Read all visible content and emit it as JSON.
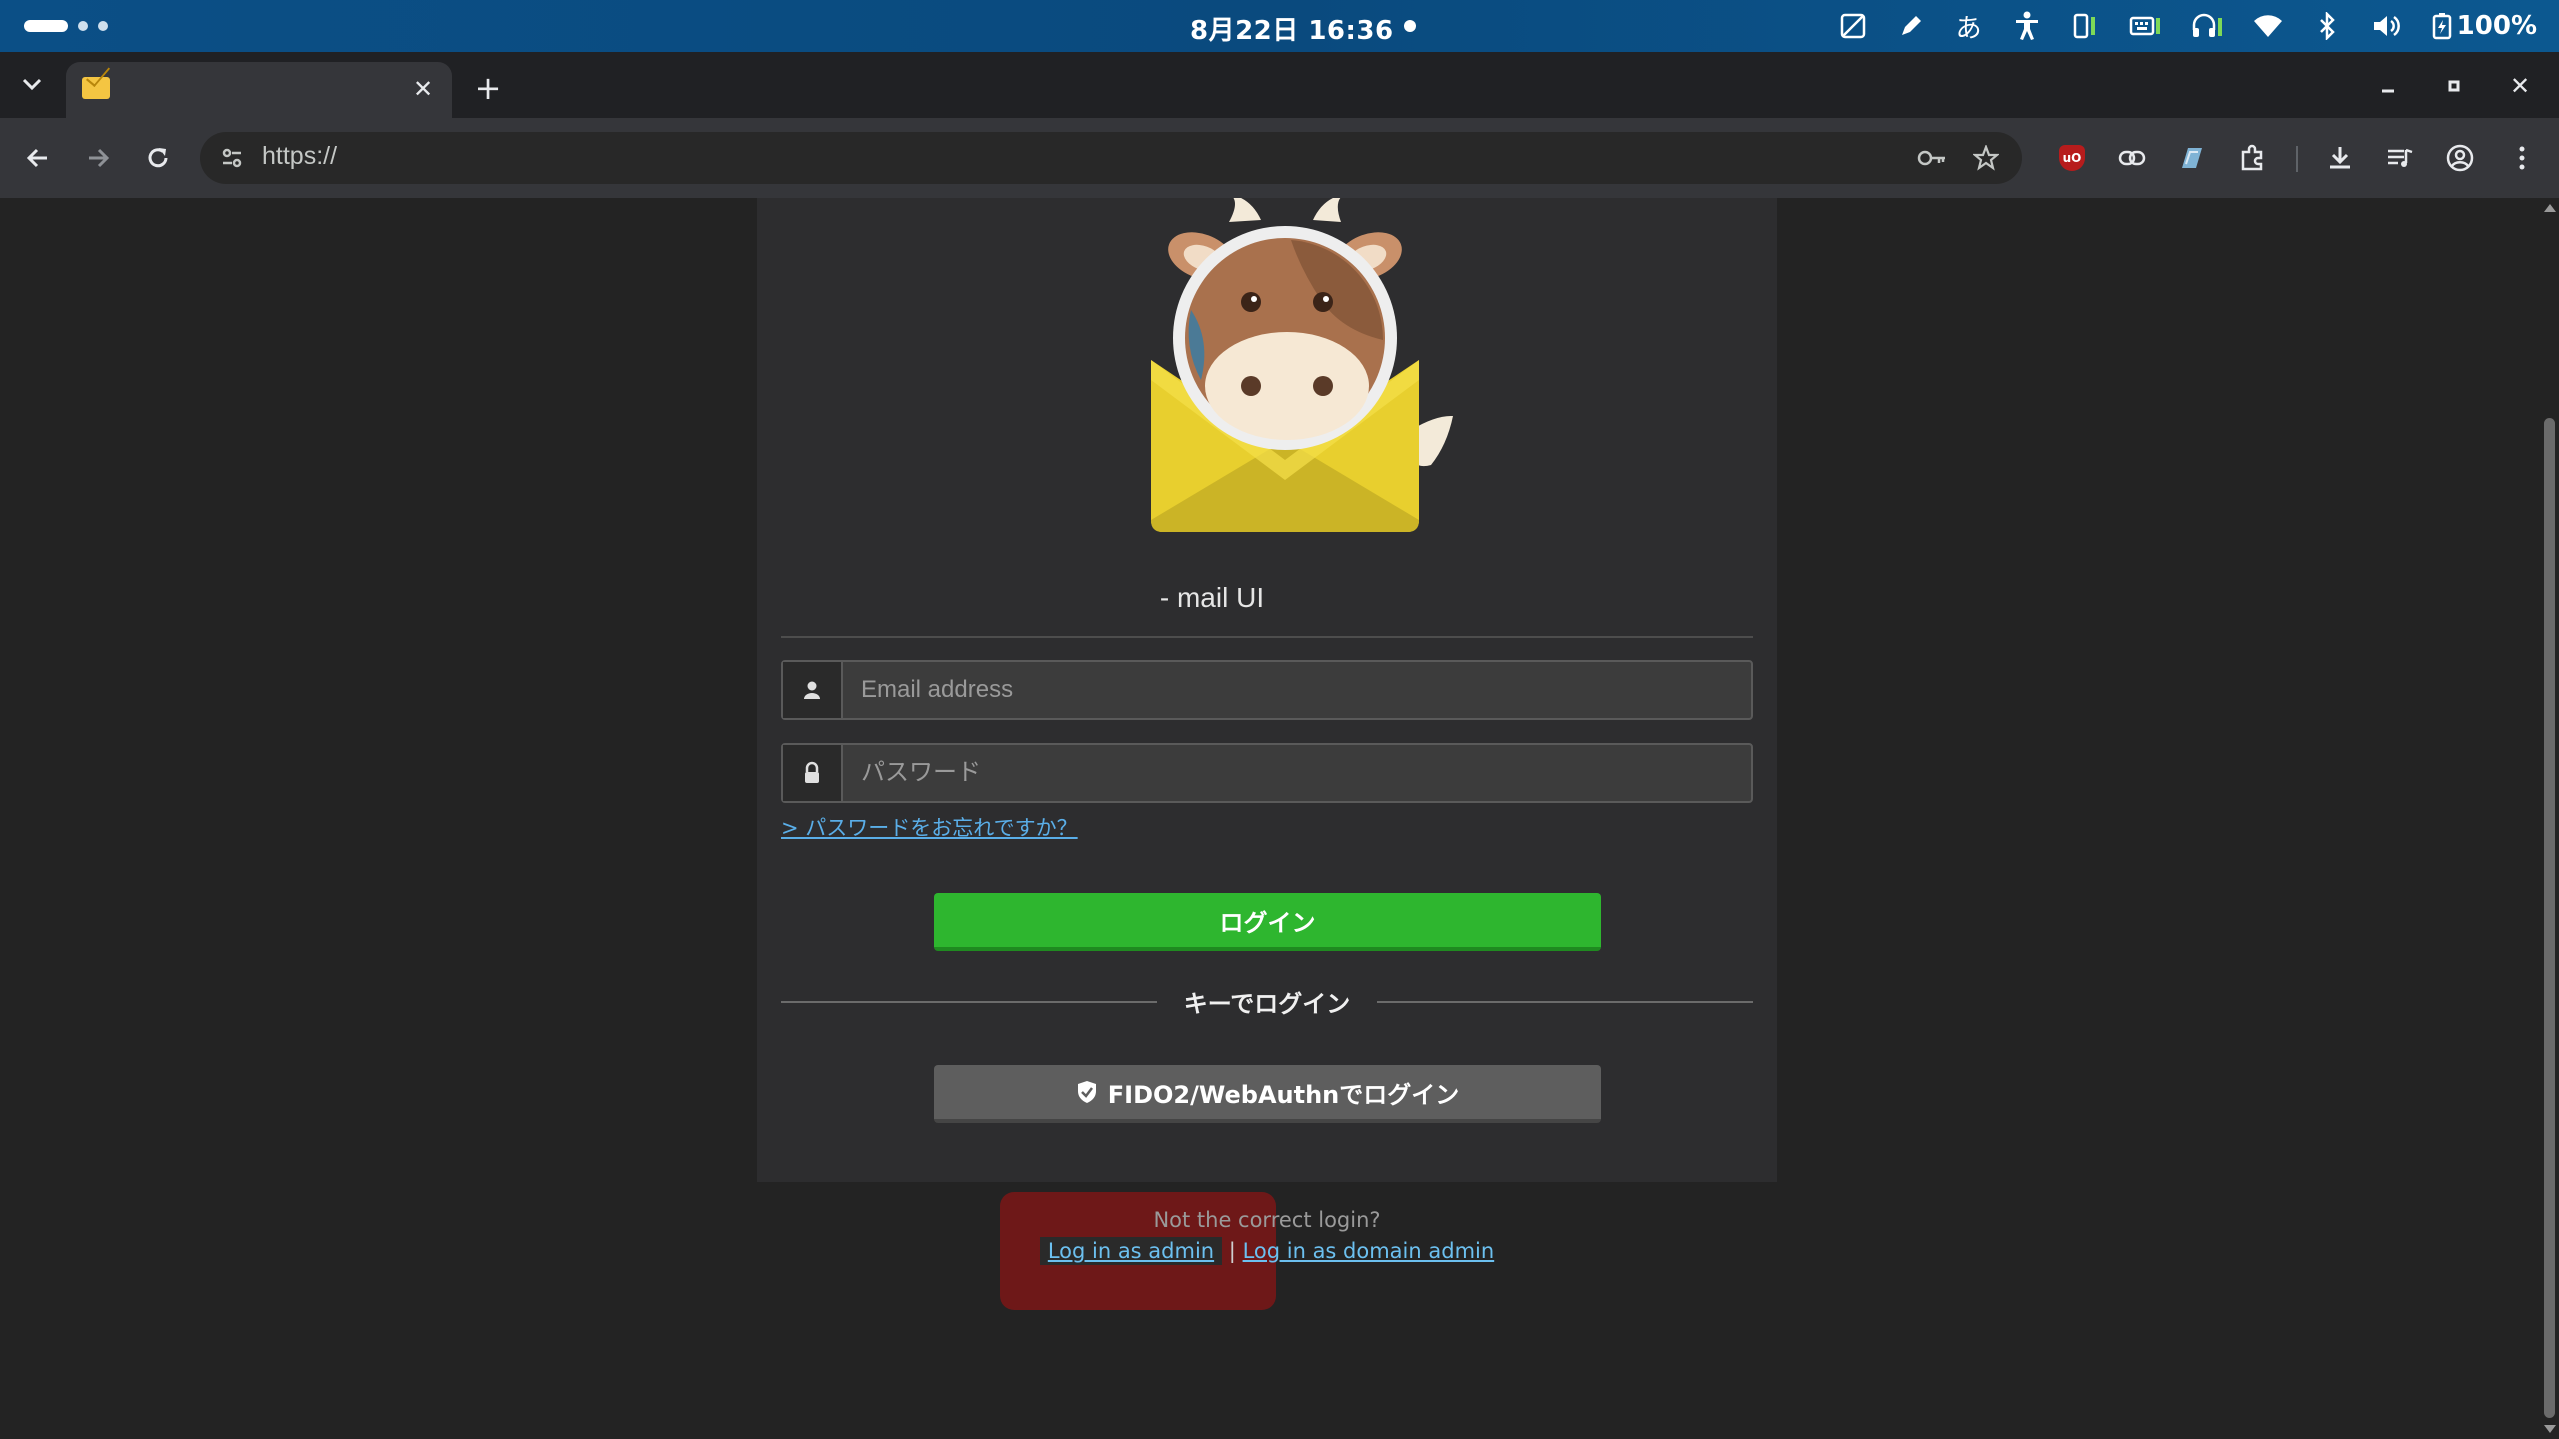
{
  "system_bar": {
    "clock": "8月22日  16:36",
    "battery": "100%",
    "ime": "あ"
  },
  "tab": {
    "title": ""
  },
  "toolbar": {
    "url": "https://"
  },
  "login": {
    "title": "- mail UI",
    "email_placeholder": "Email address",
    "password_placeholder": "パスワード",
    "forgot_link": "> パスワードをお忘れですか？",
    "login_button": "ログイン",
    "key_login_divider": "キーでログイン",
    "fido_button": "FIDO2/WebAuthnでログイン"
  },
  "footer": {
    "not_correct": "Not the correct login?",
    "admin_link": "Log in as admin",
    "separator": "|",
    "domain_admin_link": "Log in as domain admin"
  },
  "colors": {
    "login_button": "#2eb62f",
    "fido_button": "#5e5e5e",
    "link": "#5aaee8",
    "highlight": "#6e1818"
  }
}
